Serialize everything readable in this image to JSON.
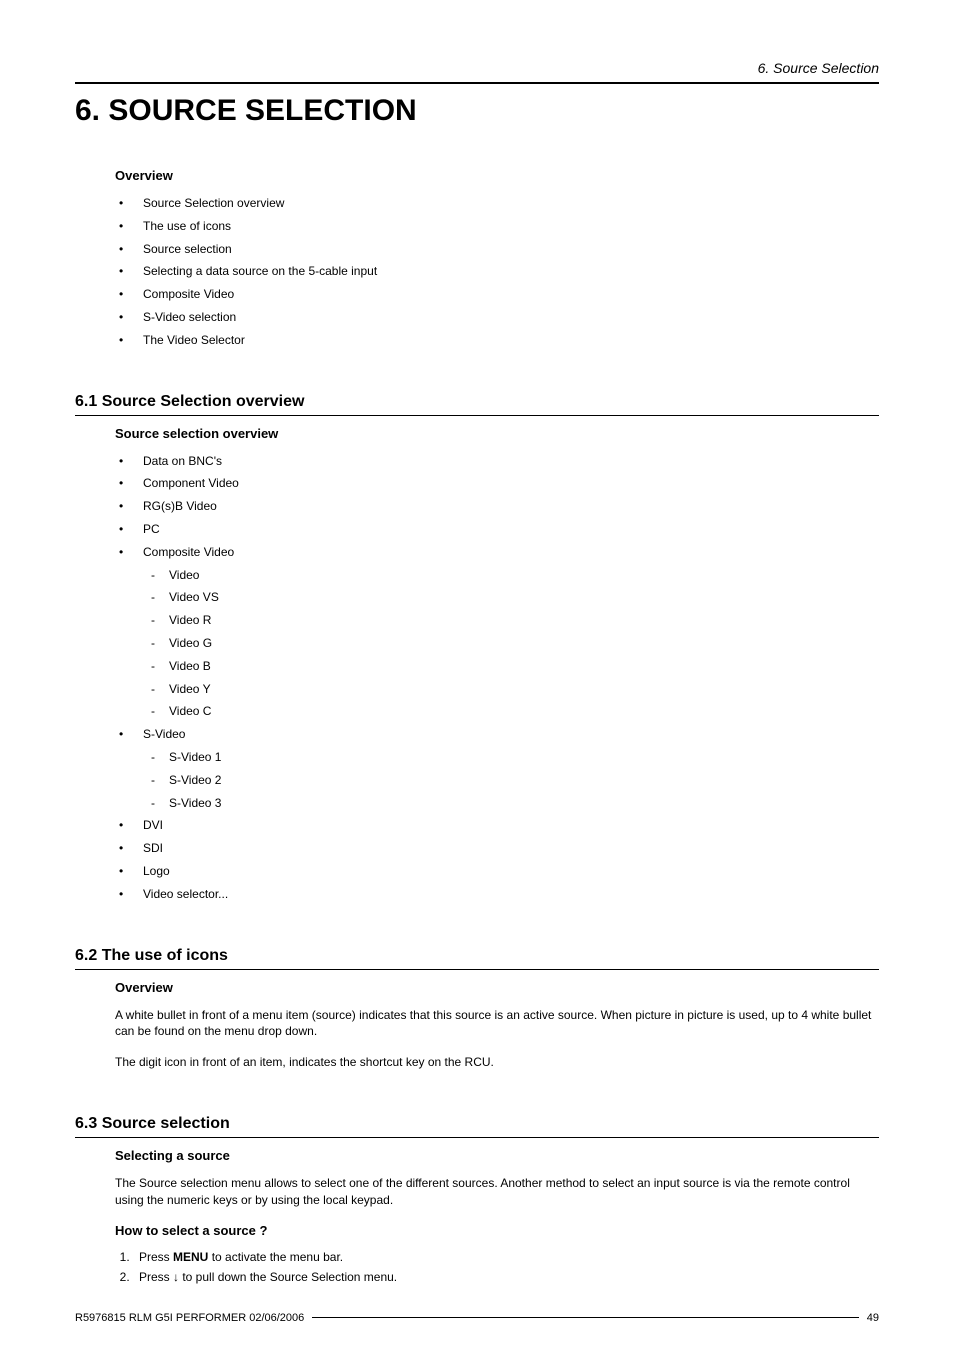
{
  "header": {
    "running_title": "6. Source Selection"
  },
  "chapter": {
    "title": "6. SOURCE SELECTION"
  },
  "overview": {
    "heading": "Overview",
    "items": [
      "Source Selection overview",
      "The use of icons",
      "Source selection",
      "Selecting a data source on the 5-cable input",
      "Composite Video",
      "S-Video selection",
      "The Video Selector"
    ]
  },
  "section_6_1": {
    "heading": "6.1   Source Selection overview",
    "sub_heading": "Source selection overview",
    "items": [
      {
        "label": "Data on BNC's"
      },
      {
        "label": "Component Video"
      },
      {
        "label": "RG(s)B Video"
      },
      {
        "label": "PC"
      },
      {
        "label": "Composite Video",
        "sub": [
          "Video",
          "Video VS",
          "Video R",
          "Video G",
          "Video B",
          "Video Y",
          "Video C"
        ]
      },
      {
        "label": "S-Video",
        "sub": [
          "S-Video 1",
          "S-Video 2",
          "S-Video 3"
        ]
      },
      {
        "label": "DVI"
      },
      {
        "label": "SDI"
      },
      {
        "label": "Logo"
      },
      {
        "label": "Video selector..."
      }
    ]
  },
  "section_6_2": {
    "heading": "6.2   The use of icons",
    "sub_heading": "Overview",
    "para1": "A white bullet in front of a menu item (source) indicates that this source is an active source. When picture in picture is used, up to 4 white bullet can be found on the menu drop down.",
    "para2": "The digit icon in front of an item, indicates the shortcut key on the RCU."
  },
  "section_6_3": {
    "heading": "6.3   Source selection",
    "sub_heading1": "Selecting a source",
    "para1": "The Source selection menu allows to select one of the different sources. Another method to select an input source is via the remote control using the numeric keys or by using the local keypad.",
    "sub_heading2": "How to select a source ?",
    "step1_prefix": "Press ",
    "step1_bold": "MENU",
    "step1_suffix": " to activate the menu bar.",
    "step2": "Press ↓ to pull down the Source Selection menu."
  },
  "footer": {
    "left": "R5976815  RLM G5I PERFORMER  02/06/2006",
    "right": "49"
  }
}
